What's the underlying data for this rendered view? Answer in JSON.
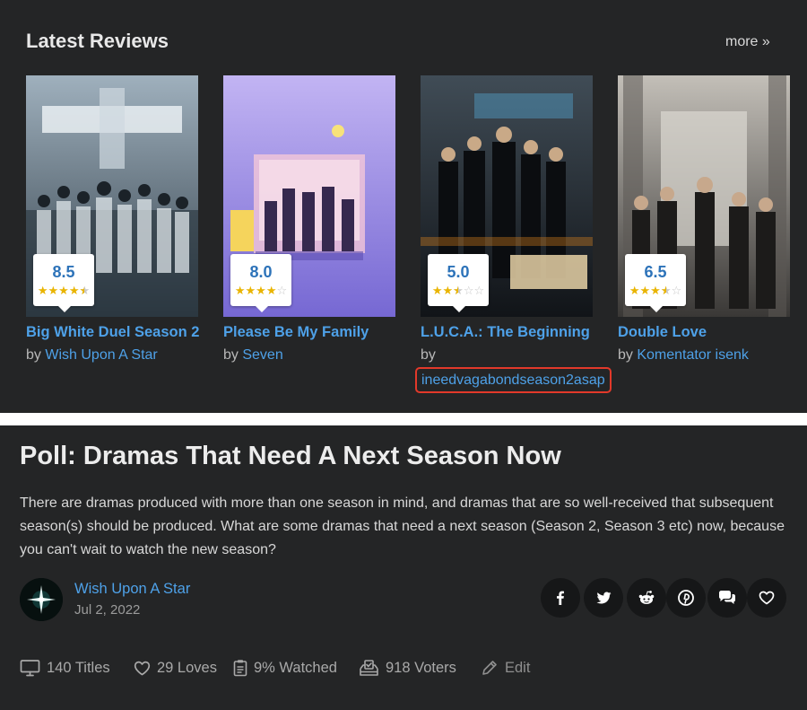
{
  "reviews": {
    "title": "Latest Reviews",
    "more_label": "more »",
    "items": [
      {
        "title": "Big White Duel Season 2",
        "score": "8.5",
        "stars": 4.5,
        "by_label": "by",
        "user": "Wish Upon A Star",
        "poster_colors": [
          "#8fa0ad",
          "#3d4b57"
        ]
      },
      {
        "title": "Please Be My Family",
        "score": "8.0",
        "stars": 4,
        "by_label": "by",
        "user": "Seven",
        "poster_colors": [
          "#b8a6ee",
          "#7b6fd4"
        ]
      },
      {
        "title": "L.U.C.A.: The Beginning",
        "score": "5.0",
        "stars": 2.5,
        "by_label": "by",
        "user": "ineedvagabondseason2asap",
        "poster_colors": [
          "#3b4650",
          "#13171b"
        ]
      },
      {
        "title": "Double Love",
        "score": "6.5",
        "stars": 3.5,
        "by_label": "by",
        "user": "Komentator isenk",
        "poster_colors": [
          "#b9b4ac",
          "#3c3a38"
        ]
      }
    ]
  },
  "poll": {
    "title": "Poll: Dramas That Need A Next Season Now",
    "description": "There are dramas produced with more than one season in mind, and dramas that are so well-received that subsequent season(s) should be produced. What are some dramas that need a next season (Season 2, Season 3 etc) now, because you can't wait to watch the new season?",
    "author": "Wish Upon A Star",
    "date": "Jul 2, 2022",
    "share_icons": [
      "facebook-icon",
      "twitter-icon",
      "reddit-icon",
      "pinterest-icon",
      "comments-icon",
      "heart-icon"
    ],
    "stats": {
      "titles": "140 Titles",
      "loves": "29 Loves",
      "watched": "9% Watched",
      "voters": "918 Voters",
      "edit": "Edit"
    }
  },
  "colors": {
    "panel_bg": "#242526",
    "link": "#4ea1e8",
    "highlight_border": "#e2392a",
    "star": "#e9b400",
    "score": "#2d73b9"
  }
}
